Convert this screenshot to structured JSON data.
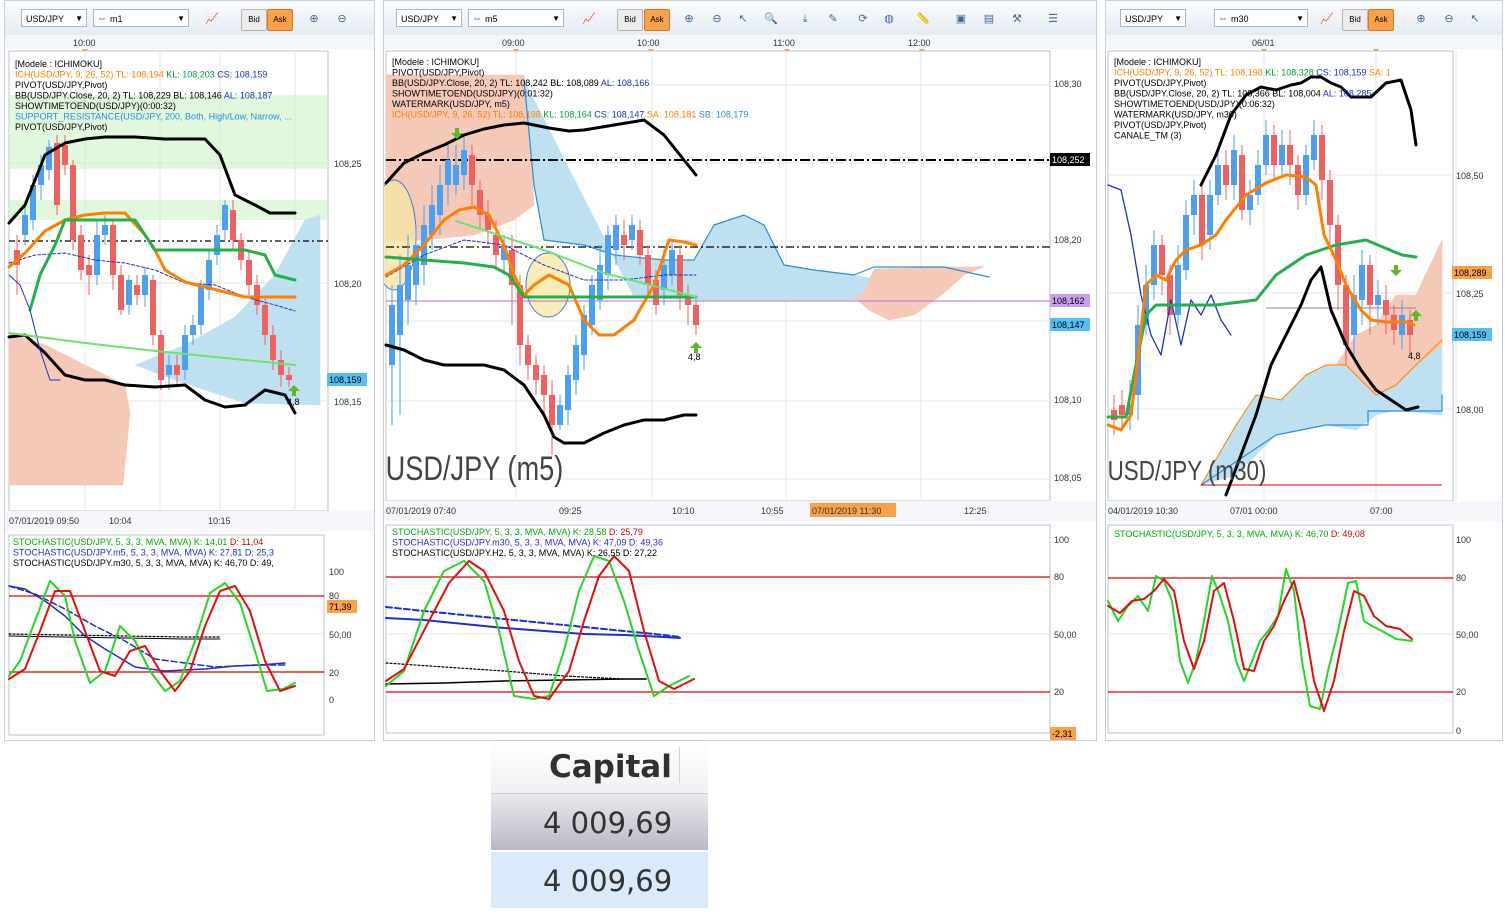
{
  "windows": [
    {
      "symbol": "USD/JPY",
      "timeframe": "m1",
      "bid": "Bid",
      "ask": "Ask",
      "top_times": [
        "10:00"
      ],
      "legend": [
        {
          "text": "[Modele : ICHIMOKU]",
          "color": "#000000"
        },
        {
          "text": "ICH(USD/JPY, 9, 26, 52)",
          "color": "#ff7f00",
          "extra": [
            [
              "TL: 108,194",
              "#ff7f00"
            ],
            [
              "KL: 108,203",
              "#00a040"
            ],
            [
              "CS: 108,159",
              "#2030c0"
            ]
          ]
        },
        {
          "text": "PIVOT(USD/JPY,Pivot)",
          "color": "#000000"
        },
        {
          "text": "BB(USD/JPY.Close, 20, 2)",
          "color": "#000000",
          "extra": [
            [
              "TL: 108,229",
              "#000000"
            ],
            [
              "BL: 108,146",
              "#000000"
            ],
            [
              "AL: 108,187",
              "#2030c0"
            ]
          ]
        },
        {
          "text": "SHOWTIMETOEND(USD/JPY)(0:00:32)",
          "color": "#000000"
        },
        {
          "text": "SUPPORT_RESISTANCE(USD/JPY, 200, Both, High/Low, Narrow, ...",
          "color": "#2a8ed8"
        },
        {
          "text": "PIVOT(USD/JPY,Pivot)",
          "color": "#000000"
        }
      ],
      "price_axis": [
        "108,25",
        "108,20",
        "108,15"
      ],
      "price_flags": [
        {
          "text": "108,159",
          "bg": "#55c0f0"
        }
      ],
      "bottom_times": [
        "07/01/2019 09:50",
        "10:04",
        "10:15"
      ],
      "signal": "4,8",
      "osc_legend": [
        {
          "text": "STOCHASTIC(USD/JPY, 5, 3, 3, MVA, MVA)",
          "color": "#00aa00",
          "extra": [
            [
              "K: 14,01",
              "#00aa00"
            ],
            [
              "D: 11,04",
              "#e00000"
            ]
          ]
        },
        {
          "text": "STOCHASTIC(USD/JPY.m5, 5, 3, 3, MVA, MVA)",
          "color": "#2030c0",
          "extra": [
            [
              "K: 27,81",
              "#2030c0"
            ],
            [
              "D: 25,3",
              "#2030c0"
            ]
          ]
        },
        {
          "text": "STOCHASTIC(USD/JPY.m30, 5, 3, 3, MVA, MVA)",
          "color": "#000000",
          "extra": [
            [
              "K: 46,70",
              "#000000"
            ],
            [
              "D: 49,",
              "#000000"
            ]
          ]
        }
      ],
      "osc_axis": [
        "100",
        "80",
        "50,00",
        "20",
        "0"
      ],
      "osc_flags": [
        {
          "text": "71,39",
          "bg": "#f7a14a"
        }
      ]
    },
    {
      "symbol": "USD/JPY",
      "timeframe": "m5",
      "bid": "Bid",
      "ask": "Ask",
      "top_times": [
        "09:00",
        "10:00",
        "11:00",
        "12:00"
      ],
      "legend": [
        {
          "text": "[Modele : ICHIMOKU]",
          "color": "#000000"
        },
        {
          "text": "PIVOT(USD/JPY,Pivot)",
          "color": "#000000"
        },
        {
          "text": "BB(USD/JPY.Close, 20, 2)",
          "color": "#000000",
          "extra": [
            [
              "TL: 108,242",
              "#000000"
            ],
            [
              "BL: 108,089",
              "#000000"
            ],
            [
              "AL: 108,166",
              "#2030c0"
            ]
          ]
        },
        {
          "text": "SHOWTIMETOEND(USD/JPY)(0:01:32)",
          "color": "#000000"
        },
        {
          "text": "WATERMARK(USD/JPY, m5)",
          "color": "#000000"
        },
        {
          "text": "ICH(USD/JPY, 9, 26, 52)",
          "color": "#ff7f00",
          "extra": [
            [
              "TL: 108,198",
              "#ff7f00"
            ],
            [
              "KL: 108,164",
              "#00a040"
            ],
            [
              "CS: 108,147",
              "#2030c0"
            ],
            [
              "SA: 108,181",
              "#ff7f00"
            ],
            [
              "SB: 108,179",
              "#2a8ed8"
            ]
          ]
        }
      ],
      "price_axis": [
        "108,30",
        "108,20",
        "108,10",
        "108,05"
      ],
      "price_flags": [
        {
          "text": "108,252",
          "bg": "#000000",
          "fg": "#ffffff"
        },
        {
          "text": "108,162",
          "bg": "#c9a0f0"
        },
        {
          "text": "108,147",
          "bg": "#55c0f0"
        }
      ],
      "bottom_times": [
        "07/01/2019 07:40",
        "09:25",
        "10:10",
        "10:55",
        "07/01/2019 11:30",
        "12:25"
      ],
      "watermark": "USD/JPY (m5)",
      "signal": "4,8",
      "osc_legend": [
        {
          "text": "STOCHASTIC(USD/JPY, 5, 3, 3, MVA, MVA)",
          "color": "#00aa00",
          "extra": [
            [
              "K: 28,58",
              "#00aa00"
            ],
            [
              "D: 25,79",
              "#e00000"
            ]
          ]
        },
        {
          "text": "STOCHASTIC(USD/JPY.m30, 5, 3, 3, MVA, MVA)",
          "color": "#2030c0",
          "extra": [
            [
              "K: 47,09",
              "#2030c0"
            ],
            [
              "D: 49,36",
              "#2030c0"
            ]
          ]
        },
        {
          "text": "STOCHASTIC(USD/JPY.H2, 5, 3, 3, MVA, MVA)",
          "color": "#000000",
          "extra": [
            [
              "K: 26,55",
              "#000000"
            ],
            [
              "D: 27,22",
              "#000000"
            ]
          ]
        }
      ],
      "osc_axis": [
        "100",
        "80",
        "50,00",
        "20"
      ],
      "osc_flags": [
        {
          "text": "-2,31",
          "bg": "#f7a14a"
        }
      ]
    },
    {
      "symbol": "USD/JPY",
      "timeframe": "m30",
      "bid": "Bid",
      "ask": "Ask",
      "top_times": [
        "06/01"
      ],
      "legend": [
        {
          "text": "[Modele : ICHIMOKU]",
          "color": "#000000"
        },
        {
          "text": "ICH(USD/JPY, 9, 26, 52)",
          "color": "#ff7f00",
          "extra": [
            [
              "TL: 108,198",
              "#ff7f00"
            ],
            [
              "KL: 108,328",
              "#00a040"
            ],
            [
              "CS: 108,159",
              "#2030c0"
            ],
            [
              "SA: 1",
              "#ff7f00"
            ]
          ]
        },
        {
          "text": "PIVOT(USD/JPY,Pivot)",
          "color": "#000000"
        },
        {
          "text": "BB(USD/JPY.Close, 20, 2)",
          "color": "#000000",
          "extra": [
            [
              "TL: 108,366",
              "#000000"
            ],
            [
              "BL: 108,004",
              "#000000"
            ],
            [
              "AL: 108,285",
              "#2030c0"
            ]
          ]
        },
        {
          "text": "SHOWTIMETOEND(USD/JPY)(0:06:32)",
          "color": "#000000"
        },
        {
          "text": "WATERMARK(USD/JPY, m30)",
          "color": "#000000"
        },
        {
          "text": "PIVOT(USD/JPY,Pivot)",
          "color": "#000000"
        },
        {
          "text": "CANALE_TM (3)",
          "color": "#000000"
        }
      ],
      "price_axis": [
        "108,50",
        "108,25",
        "108,00"
      ],
      "price_flags": [
        {
          "text": "108,289",
          "bg": "#f7a14a"
        },
        {
          "text": "108,159",
          "bg": "#55c0f0"
        }
      ],
      "bottom_times": [
        "04/01/2019 10:30",
        "07/01 00:00",
        "07:00"
      ],
      "watermark": "USD/JPY (m30)",
      "signal": "4,8",
      "osc_legend": [
        {
          "text": "STOCHASTIC(USD/JPY, 5, 3, 3, MVA, MVA)",
          "color": "#00aa00",
          "extra": [
            [
              "K: 46,70",
              "#00aa00"
            ],
            [
              "D: 49,08",
              "#e00000"
            ]
          ]
        }
      ],
      "osc_axis": [
        "100",
        "80",
        "50,00",
        "20",
        "0"
      ],
      "osc_flags": []
    }
  ],
  "capital": {
    "header": "Capital",
    "row1": "4 009,69",
    "row2": "4 009,69"
  },
  "colors": {
    "bull_candle": "#4d9fef",
    "bear_candle": "#ef6060",
    "tenkan": "#ff7f00",
    "kijun": "#22b04a",
    "bollinger": "#000000",
    "kumo_bull": "#bfe0f0",
    "kumo_bear": "#f5c9b8"
  }
}
